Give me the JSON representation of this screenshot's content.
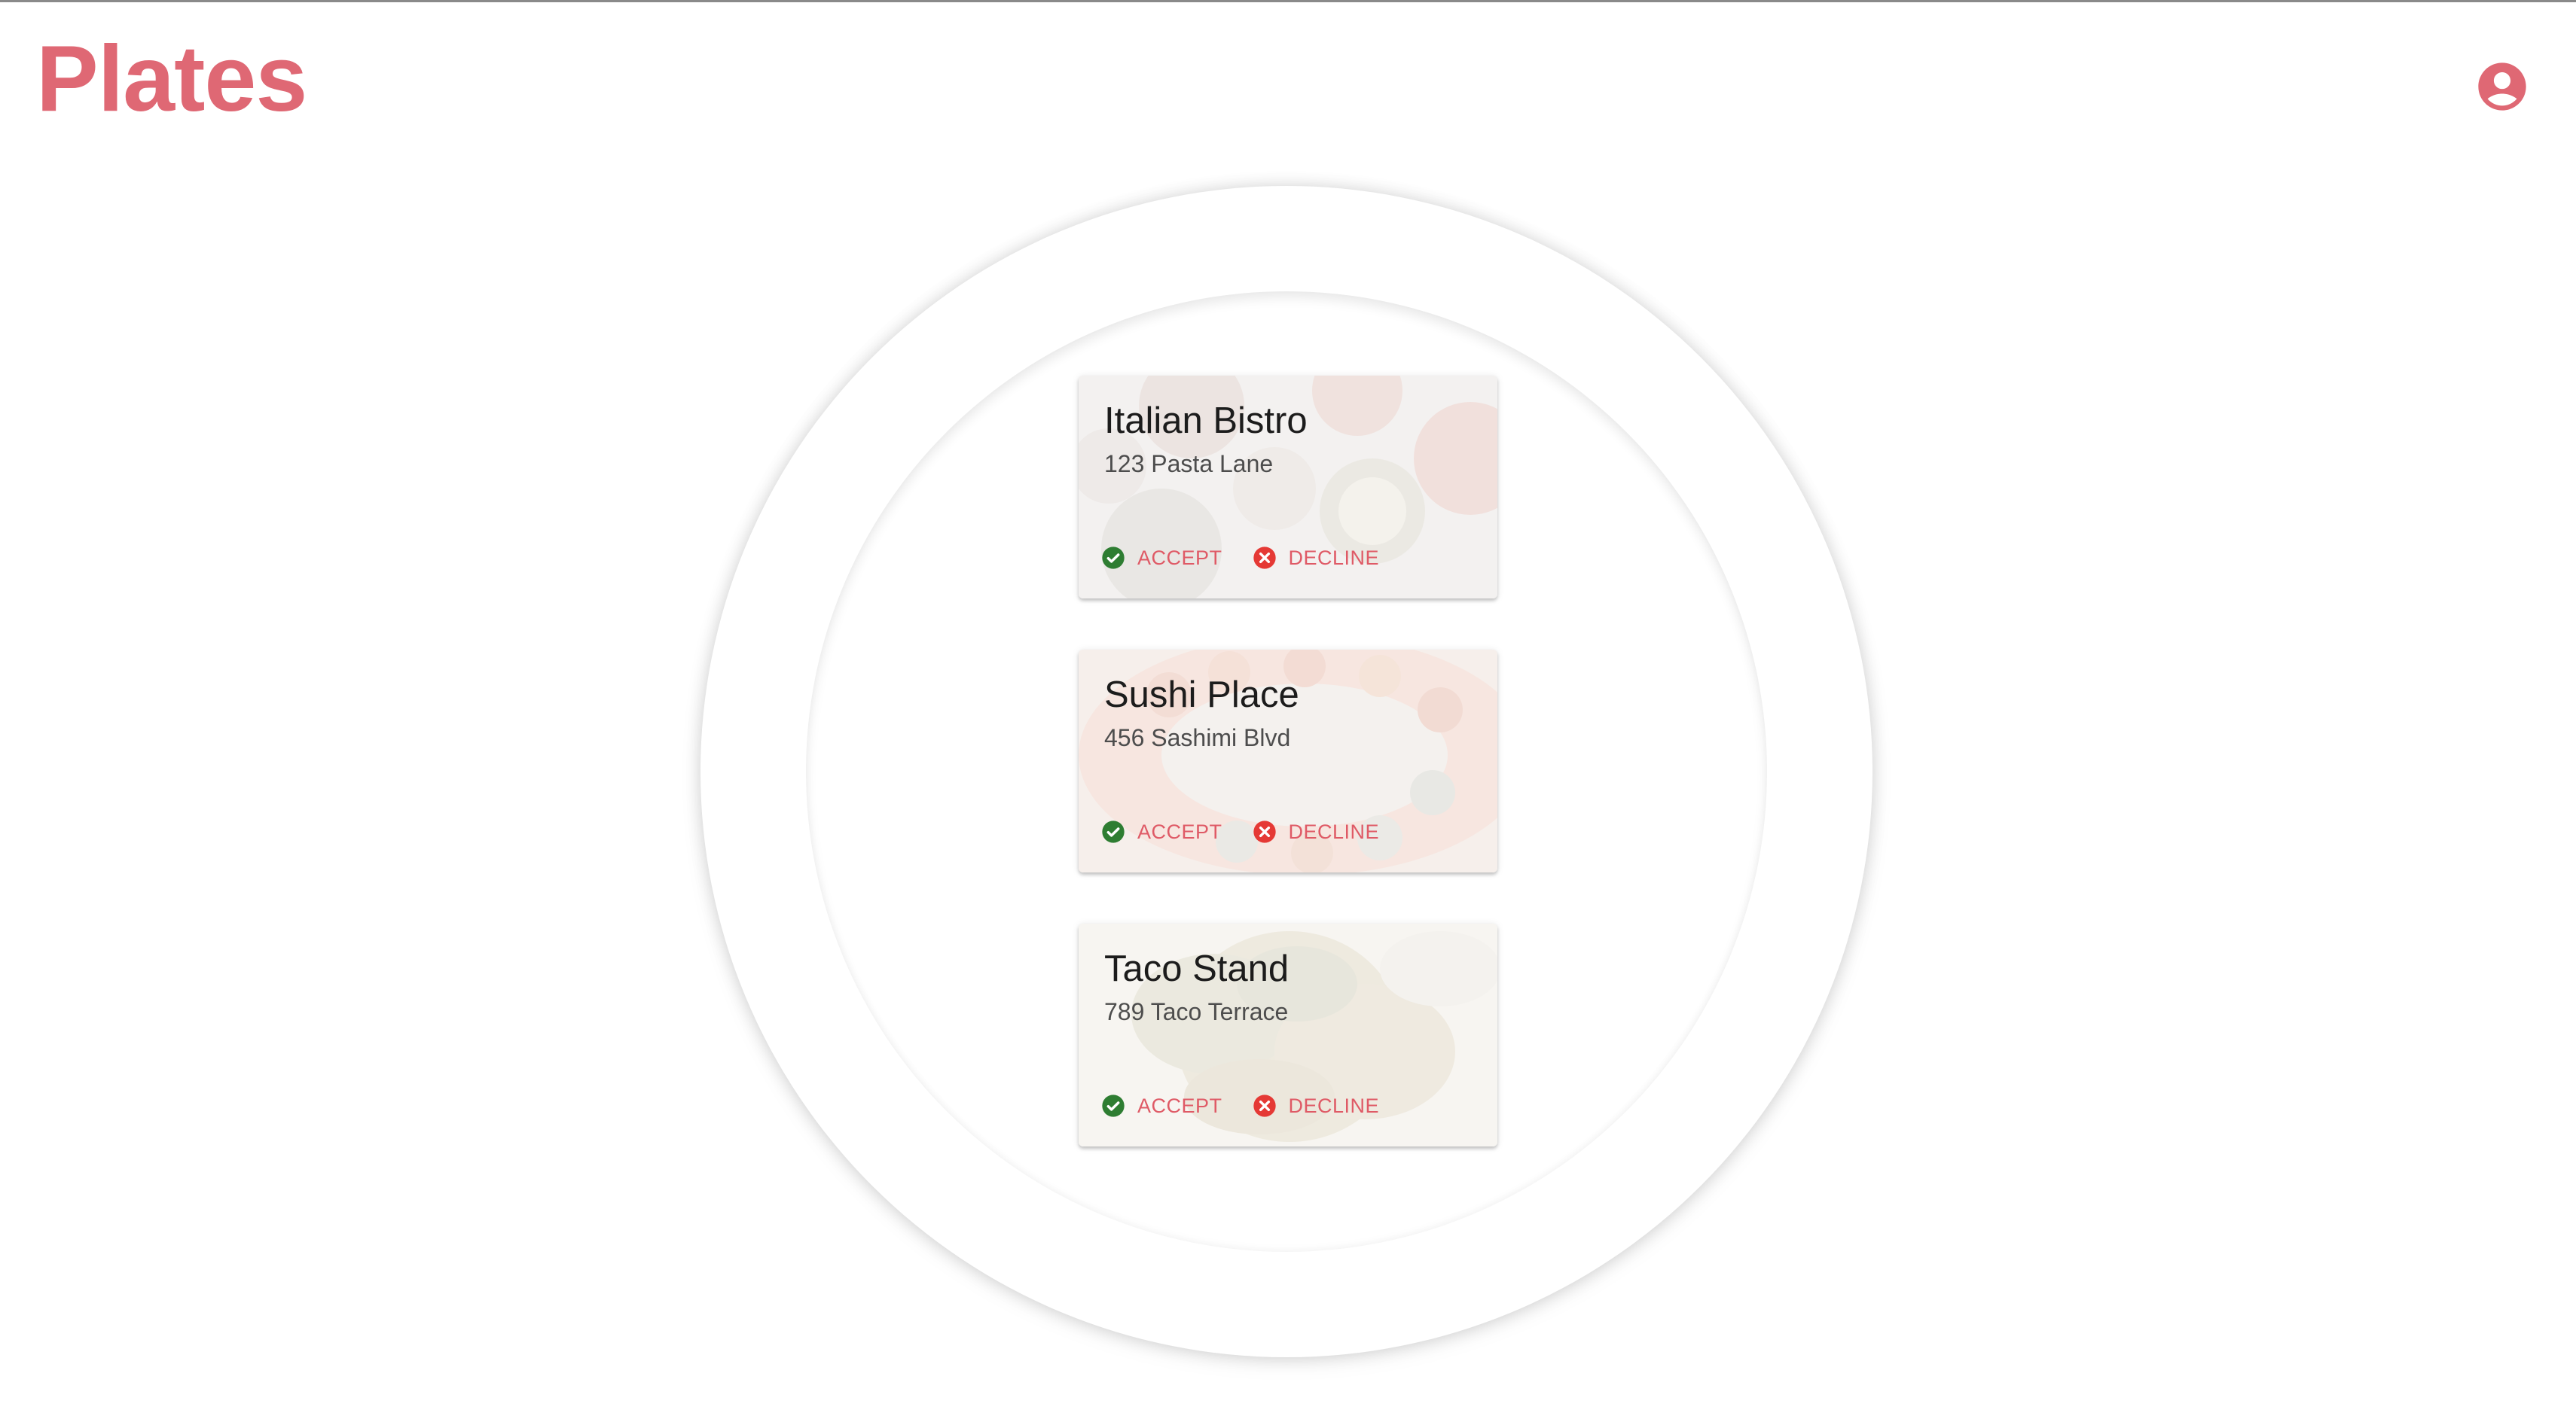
{
  "app": {
    "title": "Plates"
  },
  "header": {
    "profile_icon": "account-circle-icon"
  },
  "colors": {
    "brand": "#df6874",
    "accept_icon": "#2e7d32",
    "decline_icon": "#e53935",
    "action_text": "#df5a66"
  },
  "restaurants": [
    {
      "name": "Italian Bistro",
      "address": "123 Pasta Lane",
      "accept_label": "ACCEPT",
      "decline_label": "DECLINE",
      "accept_icon": "check-circle-icon",
      "decline_icon": "cancel-circle-icon"
    },
    {
      "name": "Sushi Place",
      "address": "456 Sashimi Blvd",
      "accept_label": "ACCEPT",
      "decline_label": "DECLINE",
      "accept_icon": "check-circle-icon",
      "decline_icon": "cancel-circle-icon"
    },
    {
      "name": "Taco Stand",
      "address": "789 Taco Terrace",
      "accept_label": "ACCEPT",
      "decline_label": "DECLINE",
      "accept_icon": "check-circle-icon",
      "decline_icon": "cancel-circle-icon"
    }
  ]
}
